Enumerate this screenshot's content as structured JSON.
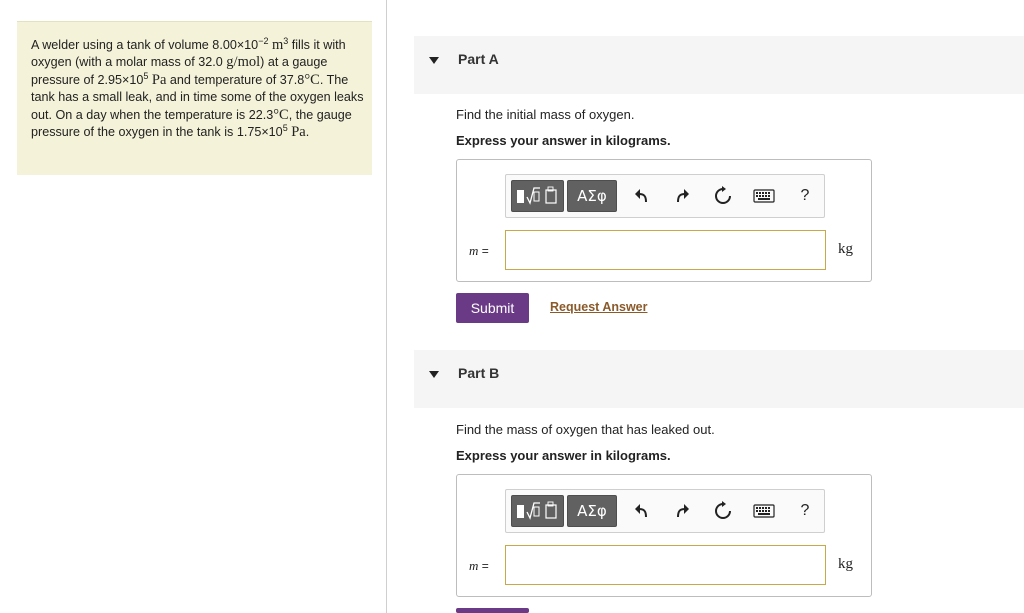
{
  "problem": {
    "p1": "A welder using a tank of volume 8.00×10",
    "vol_exp": "−2",
    "vol_unit": "m",
    "vol_unit_exp": "3",
    "p2": " fills it with oxygen (with a molar mass of 32.0 ",
    "molar_unit": "g/mol",
    "p3": ") at a gauge pressure of 2.95×10",
    "p_exp1": "5",
    "pa1": "Pa",
    "p4": " and temperature of 37.8",
    "deg1": "°C",
    "p5": ". The tank has a small leak, and in time some of the oxygen leaks out. On a day when the temperature is 22.3",
    "deg2": "°C",
    "p6": ", the gauge pressure of the oxygen in the tank is 1.75×10",
    "p_exp2": "5",
    "pa2": "Pa",
    "p7": "."
  },
  "toolbar": {
    "greek_label": "ΑΣφ",
    "help_label": "?"
  },
  "parts": [
    {
      "title": "Part A",
      "question": "Find the initial mass of oxygen.",
      "instruction": "Express your answer in kilograms.",
      "variable": "m",
      "equals": " =",
      "unit": "kg",
      "input_value": "",
      "submit_label": "Submit",
      "request_label": "Request Answer"
    },
    {
      "title": "Part B",
      "question": "Find the mass of oxygen that has leaked out.",
      "instruction": "Express your answer in kilograms.",
      "variable": "m",
      "equals": " =",
      "unit": "kg",
      "input_value": ""
    }
  ]
}
